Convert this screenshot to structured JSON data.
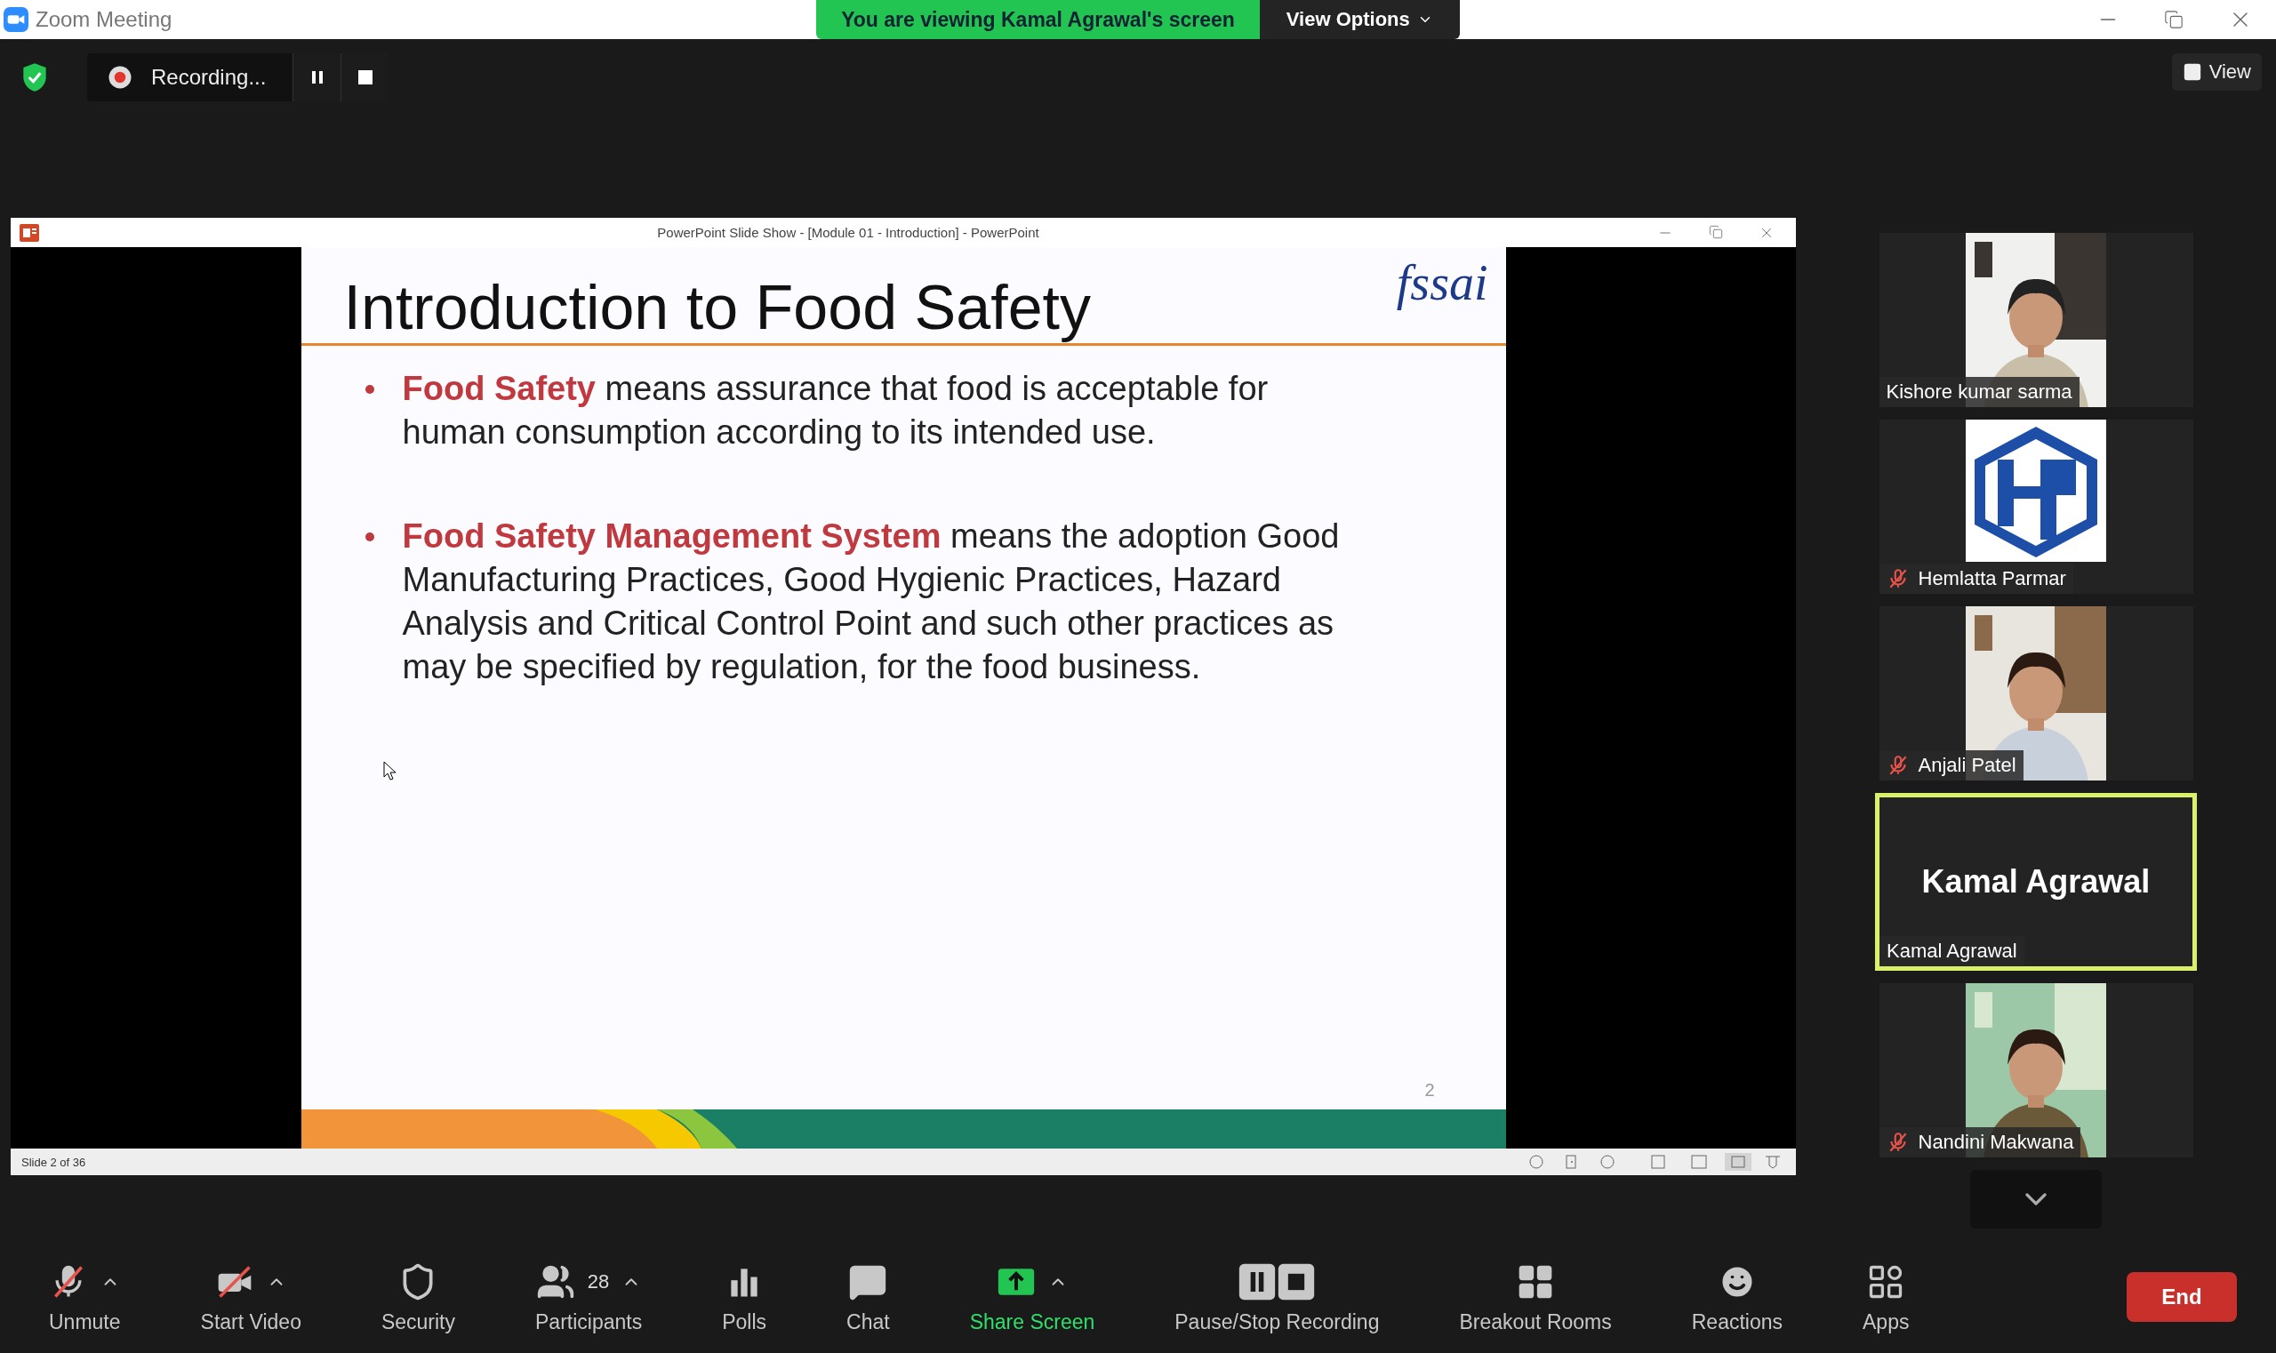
{
  "window": {
    "title": "Zoom Meeting"
  },
  "share_banner": {
    "text": "You are viewing Kamal Agrawal's screen",
    "button": "View Options"
  },
  "recording": {
    "label": "Recording..."
  },
  "view_button": "View",
  "shared_window": {
    "title": "PowerPoint Slide Show - [Module 01 - Introduction] - PowerPoint",
    "slide": {
      "title": "Introduction to Food Safety",
      "logo": "fssai",
      "bullets": [
        "**Food Safety** means assurance that food is acceptable for human consumption according to its intended use.",
        "**Food Safety Management System** means the adoption Good Manufacturing Practices, Good Hygienic Practices, Hazard Analysis and Critical Control Point and such other practices as may be specified by regulation, for the food business."
      ],
      "page_number": "2"
    },
    "status": "Slide 2 of 36"
  },
  "participants": [
    {
      "name": "Kishore kumar sarma",
      "kind": "video",
      "muted": false,
      "active": false
    },
    {
      "name": "Hemlatta Parmar",
      "kind": "logo",
      "muted": true,
      "active": false
    },
    {
      "name": "Anjali Patel",
      "kind": "video",
      "muted": true,
      "active": false
    },
    {
      "name": "Kamal Agrawal",
      "kind": "name",
      "display_name": "Kamal Agrawal",
      "muted": false,
      "active": true
    },
    {
      "name": "Nandini Makwana",
      "kind": "video",
      "muted": true,
      "active": false
    }
  ],
  "toolbar": [
    {
      "kind": "mic",
      "label": "Unmute",
      "off": true,
      "menu": true
    },
    {
      "kind": "video",
      "label": "Start Video",
      "off": true,
      "menu": true
    },
    {
      "kind": "security",
      "label": "Security",
      "menu": false
    },
    {
      "kind": "participants",
      "label": "Participants",
      "count": "28",
      "menu": true
    },
    {
      "kind": "polls",
      "label": "Polls",
      "menu": false
    },
    {
      "kind": "chat",
      "label": "Chat",
      "menu": false
    },
    {
      "kind": "share",
      "label": "Share Screen",
      "highlighted": true,
      "menu": true
    },
    {
      "kind": "record",
      "label": "Pause/Stop Recording",
      "menu": false
    },
    {
      "kind": "breakout",
      "label": "Breakout Rooms",
      "menu": false
    },
    {
      "kind": "reactions",
      "label": "Reactions",
      "menu": false
    },
    {
      "kind": "apps",
      "label": "Apps",
      "menu": false
    }
  ],
  "end_button": "End"
}
